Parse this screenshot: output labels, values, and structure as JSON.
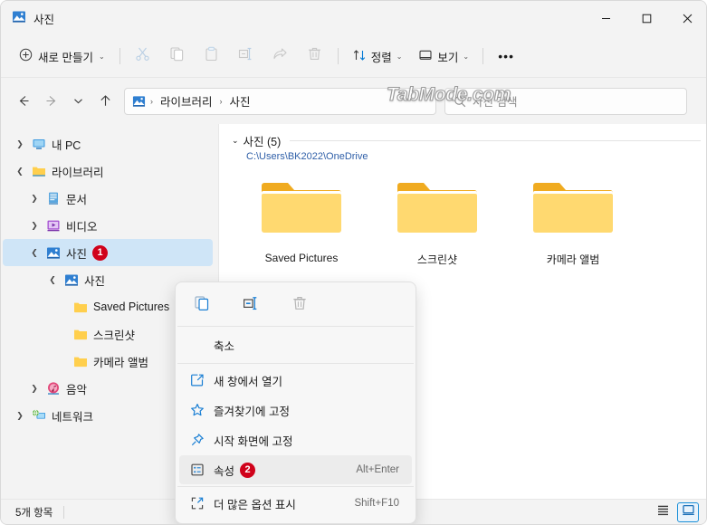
{
  "window": {
    "title": "사진",
    "title_icon": "pictures-library-icon",
    "minimize_label": "–",
    "maximize_label": "□",
    "close_label": "✕"
  },
  "toolbar": {
    "new_label": "새로 만들기",
    "new_icon": "plus-circle-icon",
    "cut_icon": "scissors-icon",
    "copy_icon": "copy-icon",
    "paste_icon": "paste-icon",
    "rename_icon": "rename-icon",
    "share_icon": "share-icon",
    "delete_icon": "trash-icon",
    "sort_label": "정렬",
    "sort_icon": "sort-arrows-icon",
    "view_label": "보기",
    "view_icon": "layout-icon",
    "more_label": "•••",
    "chevron": "⌄"
  },
  "addressbar": {
    "back_icon": "arrow-left-icon",
    "forward_icon": "arrow-right-icon",
    "recent_icon": "chevron-down-icon",
    "up_icon": "arrow-up-icon",
    "path_icon": "pictures-library-icon",
    "crumbs": [
      "라이브러리",
      "사진"
    ],
    "separator": "›"
  },
  "search": {
    "placeholder": "사진 검색",
    "icon": "search-icon"
  },
  "watermark": {
    "text": "TabMode.com"
  },
  "sidebar": {
    "items": [
      {
        "label": "내 PC",
        "icon": "monitor-icon",
        "indent": 0,
        "twisty": "collapsed",
        "selected": false
      },
      {
        "label": "라이브러리",
        "icon": "folder-icon",
        "indent": 0,
        "twisty": "expanded",
        "selected": false
      },
      {
        "label": "문서",
        "icon": "documents-icon",
        "indent": 1,
        "twisty": "collapsed",
        "selected": false
      },
      {
        "label": "비디오",
        "icon": "videos-icon",
        "indent": 1,
        "twisty": "collapsed",
        "selected": false
      },
      {
        "label": "사진",
        "icon": "pictures-icon",
        "indent": 1,
        "twisty": "expanded",
        "selected": true,
        "badge": "1"
      },
      {
        "label": "사진",
        "icon": "pictures-icon",
        "indent": 2,
        "twisty": "expanded",
        "selected": false
      },
      {
        "label": "Saved Pictures",
        "icon": "folder-icon",
        "indent": 3,
        "twisty": "none",
        "selected": false
      },
      {
        "label": "스크린샷",
        "icon": "folder-icon",
        "indent": 3,
        "twisty": "none",
        "selected": false
      },
      {
        "label": "카메라 앨범",
        "icon": "folder-icon",
        "indent": 3,
        "twisty": "none",
        "selected": false
      },
      {
        "label": "음악",
        "icon": "music-icon",
        "indent": 1,
        "twisty": "collapsed",
        "selected": false
      },
      {
        "label": "네트워크",
        "icon": "network-icon",
        "indent": 0,
        "twisty": "collapsed",
        "selected": false
      }
    ]
  },
  "content": {
    "group_title": "사진 (5)",
    "group_path": "C:\\Users\\BK2022\\OneDrive",
    "group_chevron": "⌄",
    "files": [
      {
        "label": "Saved Pictures",
        "icon": "folder-icon"
      },
      {
        "label": "스크린샷",
        "icon": "folder-icon"
      },
      {
        "label": "카메라 앨범",
        "icon": "folder-icon"
      }
    ]
  },
  "context_menu": {
    "icon_row": [
      {
        "name": "copy-icon",
        "enabled": true
      },
      {
        "name": "rename-icon",
        "enabled": true
      },
      {
        "name": "delete-icon",
        "enabled": false
      }
    ],
    "items": [
      {
        "label": "축소",
        "icon": "none",
        "accel": "",
        "active": false
      },
      {
        "label": "새 창에서 열기",
        "icon": "open-new-window-icon",
        "accel": "",
        "active": false
      },
      {
        "label": "즐겨찾기에 고정",
        "icon": "star-icon",
        "accel": "",
        "active": false
      },
      {
        "label": "시작 화면에 고정",
        "icon": "pin-icon",
        "accel": "",
        "active": false
      },
      {
        "label": "속성",
        "icon": "properties-icon",
        "accel": "Alt+Enter",
        "active": true,
        "badge": "2"
      },
      {
        "label": "더 많은 옵션 표시",
        "icon": "more-options-icon",
        "accel": "Shift+F10",
        "active": false
      }
    ]
  },
  "statusbar": {
    "item_count": "5개 항목",
    "list_view_icon": "list-view-icon",
    "tiles_view_icon": "large-icons-view-icon"
  },
  "colors": {
    "accent": "#0078d4",
    "selection": "#cfe5f7",
    "badge": "#d0021b",
    "folder": "#ffd24d",
    "window_bg": "#f3f3f3",
    "path_link": "#2f5fa8"
  }
}
